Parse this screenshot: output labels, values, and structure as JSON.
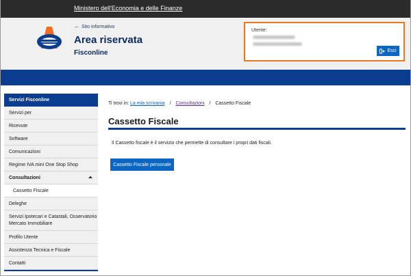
{
  "topbar": {
    "ministry_link": "Ministero dell'Economia e delle Finanze"
  },
  "header": {
    "site_link": "Sito informativo",
    "title": "Area riservata",
    "subtitle": "Fisconline",
    "logo_icon": "agenzia-entrate-logo-icon"
  },
  "user": {
    "label": "Utente:",
    "exit_label": "Esci",
    "exit_icon": "logout-icon"
  },
  "sidebar": {
    "heading": "Servizi Fisconline",
    "items": [
      {
        "label": "Servizi per"
      },
      {
        "label": "Ricevute"
      },
      {
        "label": "Software"
      },
      {
        "label": "Comunicazioni"
      },
      {
        "label": "Regime IVA mini One Stop Shop"
      },
      {
        "label": "Consultazioni"
      },
      {
        "label": "Cassetto Fiscale"
      },
      {
        "label": "Deleghe"
      },
      {
        "label": "Servizi Ipotecari e Catastali, Osservatorio Mercato Immobiliare"
      },
      {
        "label": "Profilo Utente"
      },
      {
        "label": "Assistenza Tecnica e Fiscale"
      },
      {
        "label": "Contatti"
      }
    ]
  },
  "breadcrumb": {
    "prefix": "Ti trovi in:",
    "items": [
      "La mia scrivania",
      "Consultazioni",
      "Cassetto Fiscale"
    ],
    "separator": "/"
  },
  "main": {
    "title": "Cassetto Fiscale",
    "description": "Il Cassetto fiscale è il servizio che permette di consultare i propri dati fiscali.",
    "button_label": "Cassetto Fiscale personale"
  },
  "colors": {
    "brand_blue": "#0a3d8f",
    "button_blue": "#0b66c3",
    "accent_orange": "#e87722",
    "topbar": "#2b2b2b"
  }
}
